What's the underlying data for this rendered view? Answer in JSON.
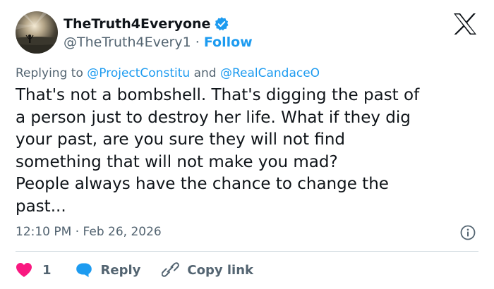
{
  "author": {
    "display_name": "TheTruth4Everyone",
    "handle": "@TheTruth4Every1",
    "separator": "·",
    "follow_label": "Follow",
    "verified": true,
    "verified_color": "#1d9bf0"
  },
  "reply_context": {
    "prefix": "Replying to",
    "mention_1": "@ProjectConstitu",
    "conjunction": "and",
    "mention_2": "@RealCandaceO"
  },
  "tweet": {
    "lines": [
      "That's not a bombshell. That's digging the past of",
      "a person just to destroy her life. What if they dig",
      "your past, are you sure they will not find",
      "something that will not make you mad?",
      "People always have the chance to change the",
      "past..."
    ]
  },
  "meta": {
    "time": "12:10 PM",
    "separator": "·",
    "date": "Feb 26, 2026"
  },
  "actions": {
    "like_count": "1",
    "reply_label": "Reply",
    "copy_label": "Copy link"
  },
  "icons": {
    "brand": "x-logo-icon",
    "verified": "verified-badge-icon",
    "info": "info-icon",
    "like": "heart-icon",
    "reply": "reply-bubble-icon",
    "copy": "link-icon"
  },
  "colors": {
    "text": "#0f1419",
    "muted": "#536471",
    "accent": "#1d9bf0",
    "like": "#f91880",
    "divider": "#cfd9de"
  }
}
